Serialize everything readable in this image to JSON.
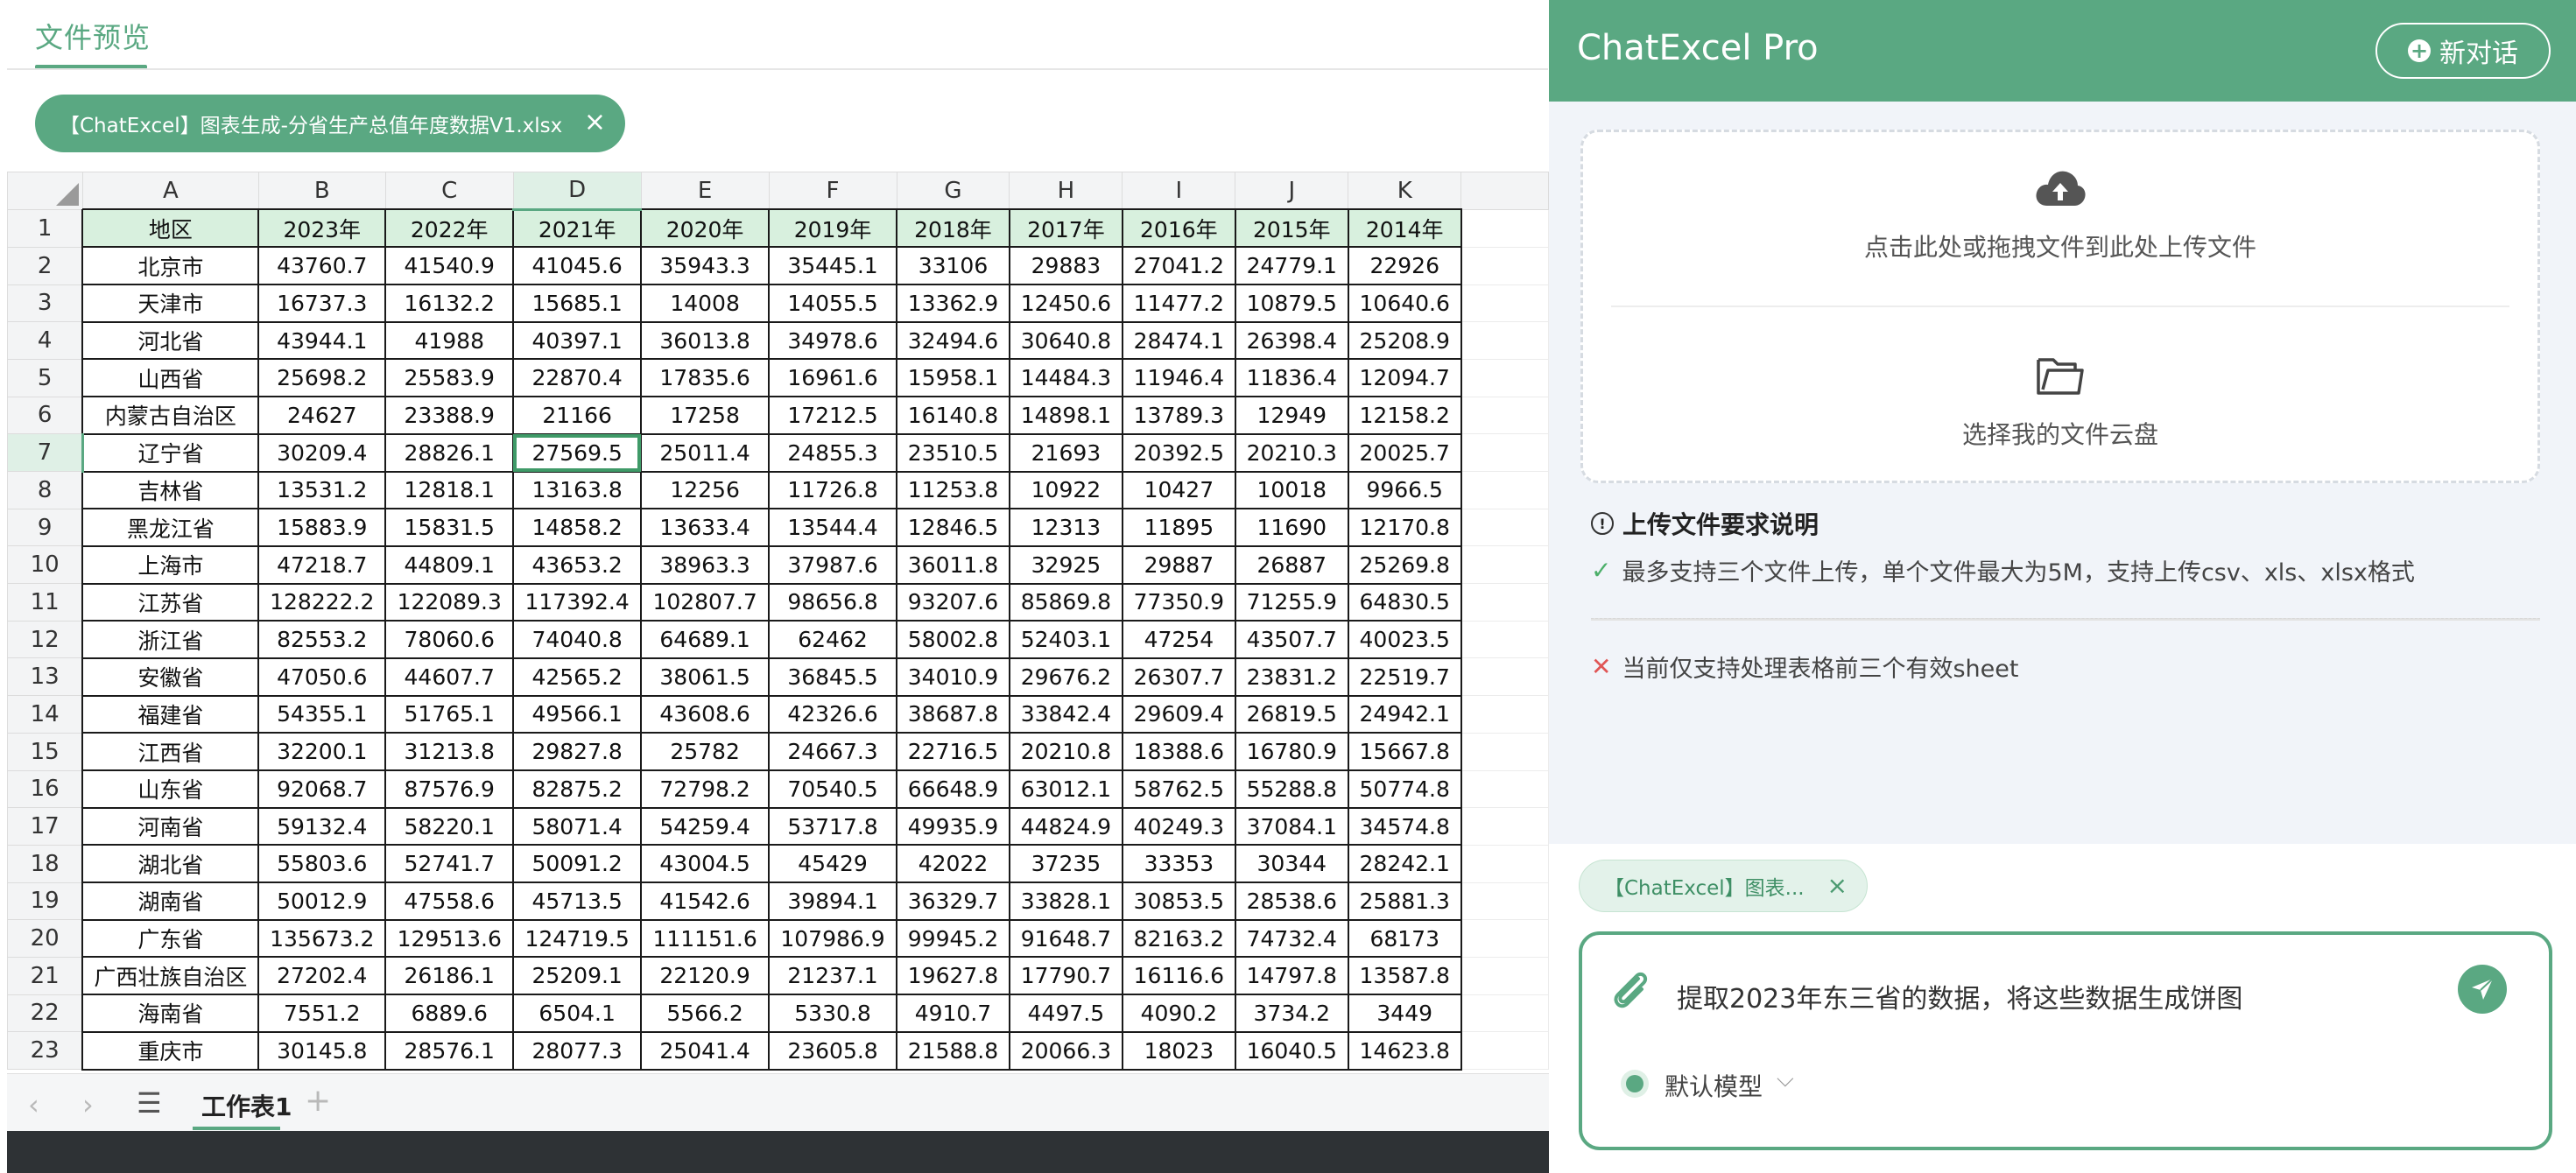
{
  "preview": {
    "tab_label": "文件预览",
    "file_chip": "【ChatExcel】图表生成-分省生产总值年度数据V1.xlsx",
    "close_glyph": "×"
  },
  "sheet": {
    "column_letters": [
      "A",
      "B",
      "C",
      "D",
      "E",
      "F",
      "G",
      "H",
      "I",
      "J",
      "K"
    ],
    "selected_column": "D",
    "selected_row": 7,
    "active_cell": "D7",
    "header_row": [
      "地区",
      "2023年",
      "2022年",
      "2021年",
      "2020年",
      "2019年",
      "2018年",
      "2017年",
      "2016年",
      "2015年",
      "2014年"
    ],
    "rows": [
      [
        "北京市",
        "43760.7",
        "41540.9",
        "41045.6",
        "35943.3",
        "35445.1",
        "33106",
        "29883",
        "27041.2",
        "24779.1",
        "22926"
      ],
      [
        "天津市",
        "16737.3",
        "16132.2",
        "15685.1",
        "14008",
        "14055.5",
        "13362.9",
        "12450.6",
        "11477.2",
        "10879.5",
        "10640.6"
      ],
      [
        "河北省",
        "43944.1",
        "41988",
        "40397.1",
        "36013.8",
        "34978.6",
        "32494.6",
        "30640.8",
        "28474.1",
        "26398.4",
        "25208.9"
      ],
      [
        "山西省",
        "25698.2",
        "25583.9",
        "22870.4",
        "17835.6",
        "16961.6",
        "15958.1",
        "14484.3",
        "11946.4",
        "11836.4",
        "12094.7"
      ],
      [
        "内蒙古自治区",
        "24627",
        "23388.9",
        "21166",
        "17258",
        "17212.5",
        "16140.8",
        "14898.1",
        "13789.3",
        "12949",
        "12158.2"
      ],
      [
        "辽宁省",
        "30209.4",
        "28826.1",
        "27569.5",
        "25011.4",
        "24855.3",
        "23510.5",
        "21693",
        "20392.5",
        "20210.3",
        "20025.7"
      ],
      [
        "吉林省",
        "13531.2",
        "12818.1",
        "13163.8",
        "12256",
        "11726.8",
        "11253.8",
        "10922",
        "10427",
        "10018",
        "9966.5"
      ],
      [
        "黑龙江省",
        "15883.9",
        "15831.5",
        "14858.2",
        "13633.4",
        "13544.4",
        "12846.5",
        "12313",
        "11895",
        "11690",
        "12170.8"
      ],
      [
        "上海市",
        "47218.7",
        "44809.1",
        "43653.2",
        "38963.3",
        "37987.6",
        "36011.8",
        "32925",
        "29887",
        "26887",
        "25269.8"
      ],
      [
        "江苏省",
        "128222.2",
        "122089.3",
        "117392.4",
        "102807.7",
        "98656.8",
        "93207.6",
        "85869.8",
        "77350.9",
        "71255.9",
        "64830.5"
      ],
      [
        "浙江省",
        "82553.2",
        "78060.6",
        "74040.8",
        "64689.1",
        "62462",
        "58002.8",
        "52403.1",
        "47254",
        "43507.7",
        "40023.5"
      ],
      [
        "安徽省",
        "47050.6",
        "44607.7",
        "42565.2",
        "38061.5",
        "36845.5",
        "34010.9",
        "29676.2",
        "26307.7",
        "23831.2",
        "22519.7"
      ],
      [
        "福建省",
        "54355.1",
        "51765.1",
        "49566.1",
        "43608.6",
        "42326.6",
        "38687.8",
        "33842.4",
        "29609.4",
        "26819.5",
        "24942.1"
      ],
      [
        "江西省",
        "32200.1",
        "31213.8",
        "29827.8",
        "25782",
        "24667.3",
        "22716.5",
        "20210.8",
        "18388.6",
        "16780.9",
        "15667.8"
      ],
      [
        "山东省",
        "92068.7",
        "87576.9",
        "82875.2",
        "72798.2",
        "70540.5",
        "66648.9",
        "63012.1",
        "58762.5",
        "55288.8",
        "50774.8"
      ],
      [
        "河南省",
        "59132.4",
        "58220.1",
        "58071.4",
        "54259.4",
        "53717.8",
        "49935.9",
        "44824.9",
        "40249.3",
        "37084.1",
        "34574.8"
      ],
      [
        "湖北省",
        "55803.6",
        "52741.7",
        "50091.2",
        "43004.5",
        "45429",
        "42022",
        "37235",
        "33353",
        "30344",
        "28242.1"
      ],
      [
        "湖南省",
        "50012.9",
        "47558.6",
        "45713.5",
        "41542.6",
        "39894.1",
        "36329.7",
        "33828.1",
        "30853.5",
        "28538.6",
        "25881.3"
      ],
      [
        "广东省",
        "135673.2",
        "129513.6",
        "124719.5",
        "111151.6",
        "107986.9",
        "99945.2",
        "91648.7",
        "82163.2",
        "74732.4",
        "68173"
      ],
      [
        "广西壮族自治区",
        "27202.4",
        "26186.1",
        "25209.1",
        "22120.9",
        "21237.1",
        "19627.8",
        "17790.7",
        "16116.6",
        "14797.8",
        "13587.8"
      ],
      [
        "海南省",
        "7551.2",
        "6889.6",
        "6504.1",
        "5566.2",
        "5330.8",
        "4910.7",
        "4497.5",
        "4090.2",
        "3734.2",
        "3449"
      ],
      [
        "重庆市",
        "30145.8",
        "28576.1",
        "28077.3",
        "25041.4",
        "23605.8",
        "21588.8",
        "20066.3",
        "18023",
        "16040.5",
        "14623.8"
      ]
    ],
    "tab_name": "工作表1",
    "nav_prev": "‹",
    "nav_next": "›",
    "menu_glyph": "☰",
    "add_glyph": "+"
  },
  "assistant": {
    "title": "ChatExcel Pro",
    "new_chat_label": "新对话",
    "upload_hint": "点击此处或拖拽文件到此处上传文件",
    "cloud_hint": "选择我的文件云盘",
    "requirements_title": "上传文件要求说明",
    "requirement_ok": "最多支持三个文件上传，单个文件最大为5M，支持上传csv、xls、xlsx格式",
    "requirement_no": "当前仅支持处理表格前三个有效sheet",
    "attached_file": "【ChatExcel】图表...",
    "prompt": "提取2023年东三省的数据，将这些数据生成饼图",
    "model_label": "默认模型",
    "accent_color": "#5aa882",
    "icons": [
      "cloud-upload-icon",
      "folder-icon",
      "info-icon",
      "check-icon",
      "cross-icon",
      "paperclip-icon",
      "send-icon",
      "chevron-down-icon",
      "plus-circle-icon"
    ]
  }
}
